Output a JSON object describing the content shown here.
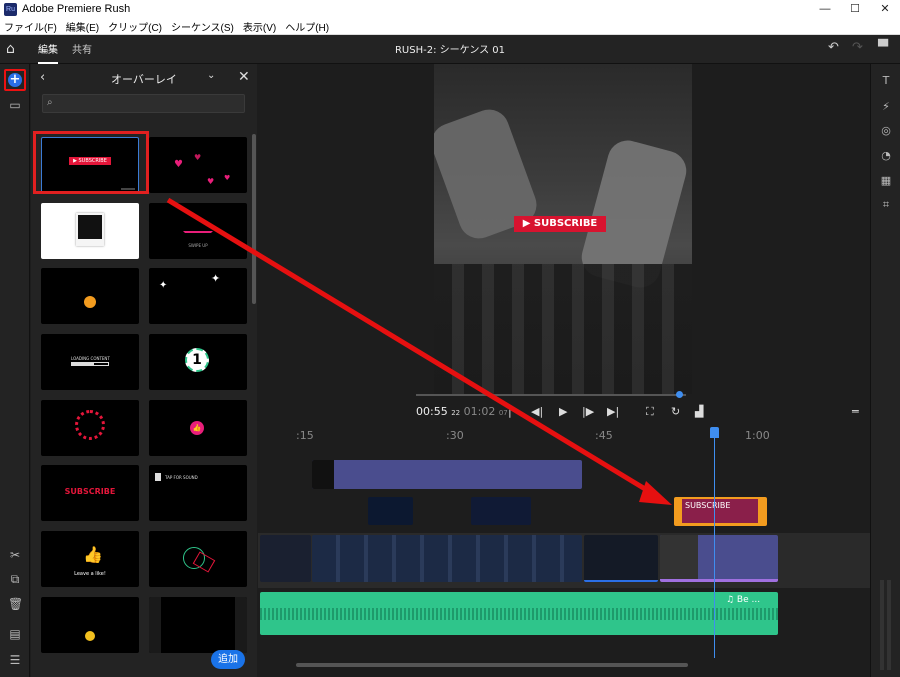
{
  "window": {
    "app_title": "Adobe Premiere Rush",
    "icon_label": "Ru",
    "minimize": "—",
    "maximize": "☐",
    "close": "✕"
  },
  "menu": [
    "ファイル(F)",
    "編集(E)",
    "クリップ(C)",
    "シーケンス(S)",
    "表示(V)",
    "ヘルプ(H)"
  ],
  "topbar": {
    "tab_edit": "編集",
    "tab_share": "共有",
    "sequence_title": "RUSH-2: シーケンス 01"
  },
  "panel": {
    "title": "オーバーレイ",
    "search_placeholder": "",
    "add_button": "追加",
    "thumbs": {
      "subscribe": "▶ SUBSCRIBE",
      "swipe": "SWIPE UP",
      "loading": "LOADING CONTENT",
      "subscribe_big": "SUBSCRIBE",
      "tap_sound": "TAP FOR SOUND",
      "leave_like": "Leave a like!"
    }
  },
  "preview": {
    "overlay_text": "▶ SUBSCRIBE"
  },
  "transport": {
    "current_time": "00:55",
    "current_frames": "22",
    "total_time": "01:02",
    "total_frames": "07"
  },
  "ruler": [
    ":15",
    ":30",
    ":45",
    "1:00"
  ],
  "timeline": {
    "overlay_clip_label": "SUBSCRIBE",
    "audio_clip_label": "♫  Be ..."
  },
  "colors": {
    "accent": "#1a73e8",
    "highlight": "#e12020",
    "audio": "#2fc58b",
    "overlay_orange": "#f39c1f"
  }
}
